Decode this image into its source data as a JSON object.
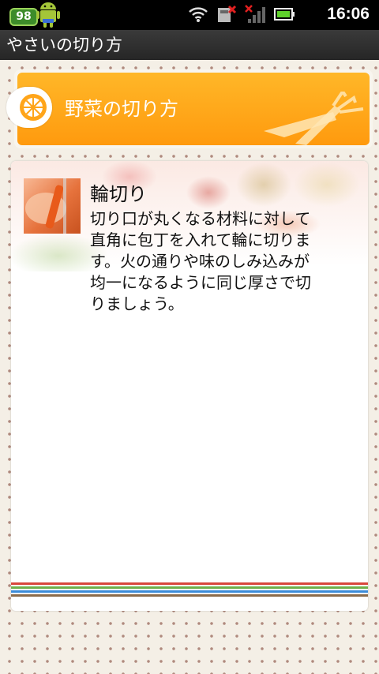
{
  "status_bar": {
    "notification_count": "98",
    "time": "16:06"
  },
  "app": {
    "title": "やさいの切り方"
  },
  "header": {
    "title": "野菜の切り方"
  },
  "item": {
    "title": "輪切り",
    "body_lines": [
      "切り口が丸くなる材料に対して",
      "直角に包丁を入れて輪に切りま",
      "す。火の通りや味のしみ込みが",
      "均一になるように同じ厚さで切",
      "りましょう。"
    ]
  },
  "colors": {
    "header_orange": "#ffa51a",
    "polka_dot": "#b08a7e",
    "stripe_red": "#d8463b",
    "stripe_green": "#6fb04b",
    "stripe_blue": "#3b8bd8",
    "stripe_brown": "#8b6b4a"
  }
}
